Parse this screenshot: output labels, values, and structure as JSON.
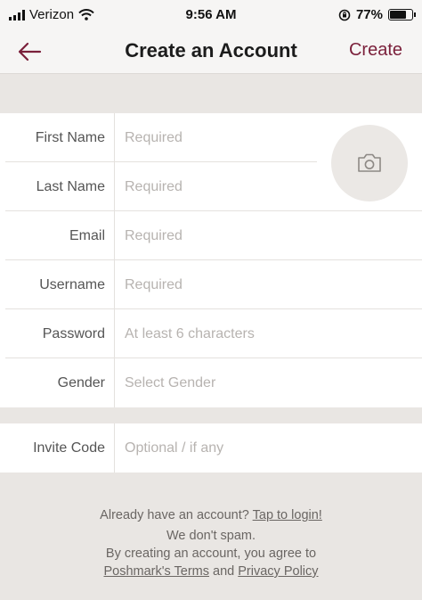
{
  "status_bar": {
    "carrier": "Verizon",
    "time": "9:56 AM",
    "battery": "77%",
    "battery_level": 0.77
  },
  "nav": {
    "title": "Create an Account",
    "create_label": "Create",
    "back_icon": "arrow-left-icon"
  },
  "form": {
    "first_name": {
      "label": "First Name",
      "placeholder": "Required"
    },
    "last_name": {
      "label": "Last Name",
      "placeholder": "Required"
    },
    "email": {
      "label": "Email",
      "placeholder": "Required"
    },
    "username": {
      "label": "Username",
      "placeholder": "Required"
    },
    "password": {
      "label": "Password",
      "placeholder": "At least 6 characters"
    },
    "gender": {
      "label": "Gender",
      "placeholder": "Select Gender"
    },
    "photo_icon": "camera-icon"
  },
  "invite": {
    "label": "Invite Code",
    "placeholder": "Optional / if any"
  },
  "footer": {
    "login_prompt": "Already have an account?",
    "login_link": "Tap to login!",
    "no_spam": "We don't spam.",
    "agree_text": "By creating an account, you agree to",
    "terms_link": "Poshmark's Terms",
    "and_text": "and",
    "privacy_link": "Privacy Policy"
  },
  "colors": {
    "accent": "#7a1f3a",
    "background": "#e9e6e3",
    "placeholder": "#b7b3b0"
  }
}
